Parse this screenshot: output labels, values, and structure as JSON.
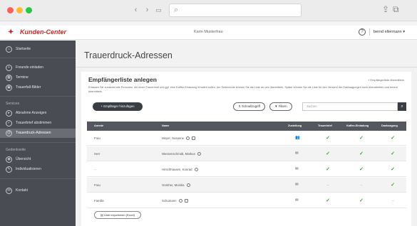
{
  "browser": {
    "back_icon": "chevron-left-icon",
    "forward_icon": "chevron-right-icon"
  },
  "app": {
    "title": "Kunden-Center",
    "account_name": "Karin Musterfrau",
    "user_menu": "bernd ellermann"
  },
  "sidebar": {
    "items": [
      {
        "label": "Startseite",
        "icon": "home-icon"
      },
      {
        "label": "Freunde einladen",
        "icon": "invite-icon"
      },
      {
        "label": "Termine",
        "icon": "calendar-icon"
      },
      {
        "label": "Trauerfall-Bilder",
        "icon": "image-icon"
      }
    ],
    "services_heading": "Services",
    "services": [
      {
        "label": "Abnahme Anzeigen",
        "icon": "play-icon"
      },
      {
        "label": "Trauerbrief abstimmen",
        "icon": "check-icon"
      },
      {
        "label": "Trauerdruck-Adressen",
        "icon": "address-icon",
        "active": true
      }
    ],
    "guestbook_heading": "Gedenkseite",
    "guestbook": [
      {
        "label": "Übersicht",
        "icon": "overview-icon"
      },
      {
        "label": "Individualisieren",
        "icon": "customize-icon"
      }
    ],
    "contact": {
      "label": "Kontakt",
      "icon": "contact-icon"
    }
  },
  "main": {
    "page_title": "Trauerdruck-Adressen",
    "card_title": "Empfängerliste anlegen",
    "help_link": "+ Empfängerliste übermitteln",
    "description": "Erfassen Sie zunächst alle Personen, die einen Trauerbrief und ggf. eine Kaffee-Einladung erhalten sollen. Am Seitenende können Sie die Liste an uns übermitteln. Später können Sie die Liste für den Versand der Danksagungen noch überarbeiten und erneut übermitteln.",
    "add_button": "+ Empfänger hinzufügen",
    "quick_button": "Schnellzugriff",
    "filter_button": "Filtern",
    "search_placeholder": "Suchen",
    "columns": [
      "Anrede",
      "Name",
      "Zustellung",
      "Trauerbrief",
      "Kaffee-Einladung",
      "Danksagung"
    ],
    "rows": [
      {
        "anrede": "Frau",
        "name": "Meyer, Susanne",
        "zustellung": "group",
        "trauerbrief": true,
        "kaffee": true,
        "danksagung": true
      },
      {
        "anrede": "Herr",
        "name": "Wessenschmidt, Markus",
        "zustellung": "mail",
        "trauerbrief": true,
        "kaffee": true,
        "danksagung": true
      },
      {
        "anrede": "–",
        "name": "Hirschhausen, Konrad",
        "zustellung": "mail",
        "trauerbrief": true,
        "kaffee": true,
        "danksagung": true
      },
      {
        "anrede": "Frau",
        "name": "Günther, Monika",
        "zustellung": "mail",
        "trauerbrief": false,
        "kaffee": false,
        "danksagung": true
      },
      {
        "anrede": "Familie",
        "name": "Schumann",
        "zustellung": "mail",
        "trauerbrief": true,
        "kaffee": true,
        "danksagung": false
      }
    ],
    "export_button": "Liste exportieren (Excel)"
  }
}
